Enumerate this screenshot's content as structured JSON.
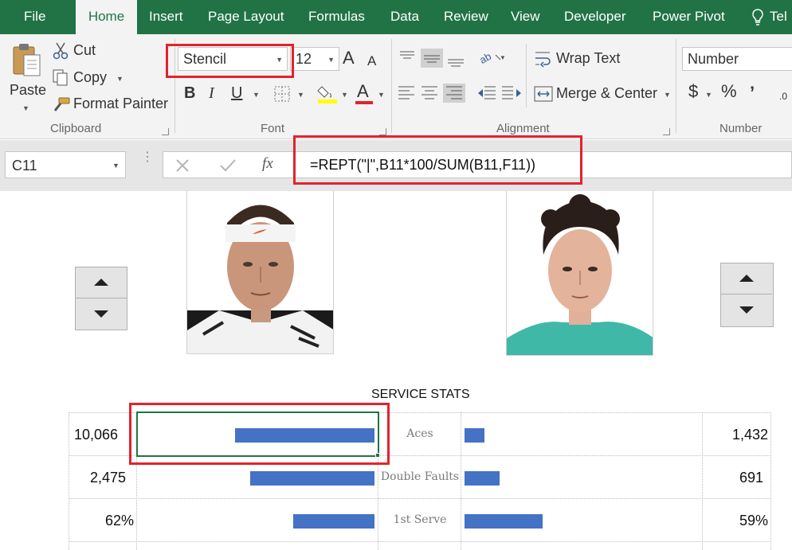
{
  "tabs": [
    "File",
    "Home",
    "Insert",
    "Page Layout",
    "Formulas",
    "Data",
    "Review",
    "View",
    "Developer",
    "Power Pivot",
    "Tel"
  ],
  "active_tab": "Home",
  "clipboard": {
    "paste": "Paste",
    "cut": "Cut",
    "copy": "Copy",
    "format_painter": "Format Painter",
    "group": "Clipboard"
  },
  "font": {
    "name": "Stencil",
    "size": "12",
    "group": "Font",
    "bold": "B",
    "italic": "I",
    "underline": "U",
    "grow": "A",
    "shrink": "A",
    "font_color": "A"
  },
  "alignment": {
    "wrap_text": "Wrap Text",
    "merge_center": "Merge & Center",
    "group": "Alignment"
  },
  "number": {
    "format": "Number",
    "currency": "$",
    "percent": "%",
    "comma": "’",
    "decimals": ".0",
    "group": "Number"
  },
  "formula_bar": {
    "name_box": "C11",
    "fx": "fx",
    "formula": "=REPT(\"|\",B11*100/SUM(B11,F11))"
  },
  "sheet": {
    "heading": "SERVICE STATS",
    "rows": [
      {
        "left": "10,066",
        "stat": "Aces",
        "right": "1,432",
        "left_share": 0.875,
        "right_share": 0.125
      },
      {
        "left": "2,475",
        "stat": "Double Faults",
        "right": "691",
        "left_share": 0.78,
        "right_share": 0.22
      },
      {
        "left": "62%",
        "stat": "1st Serve",
        "right": "59%",
        "left_share": 0.51,
        "right_share": 0.49
      }
    ]
  },
  "colors": {
    "excel_green": "#217346",
    "bar_blue": "#4472c4",
    "highlight_red": "#e1232e"
  }
}
